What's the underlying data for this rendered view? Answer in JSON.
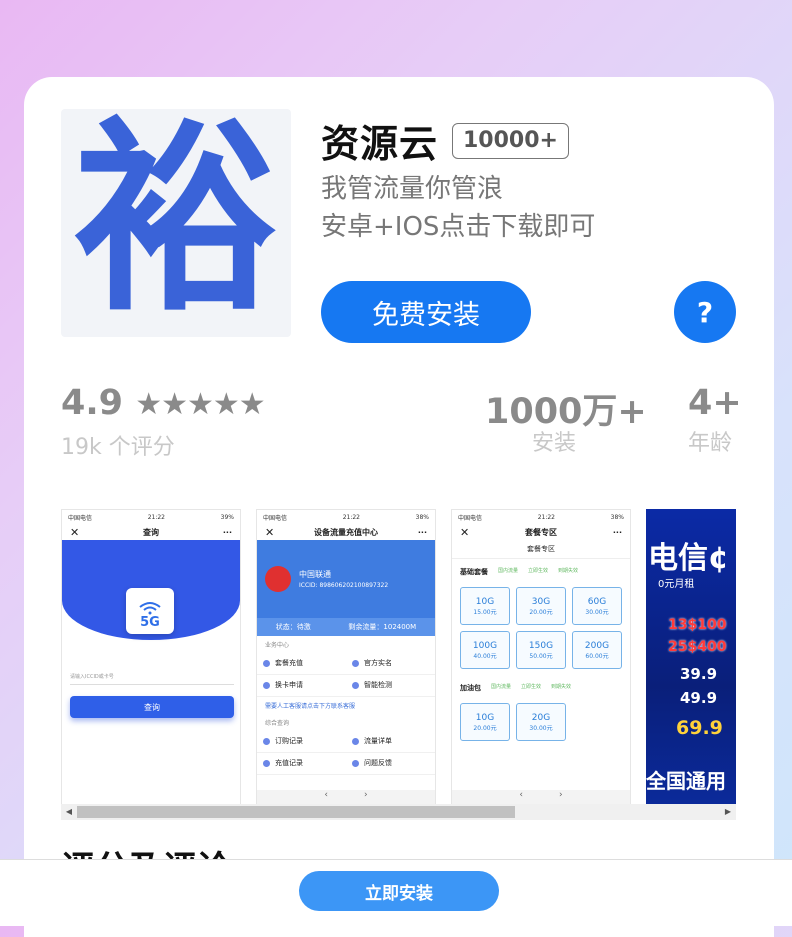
{
  "app": {
    "icon_glyph": "裕",
    "name": "资源云",
    "downloads_badge": "10000+",
    "slogan_line1": "我管流量你管浪",
    "slogan_line2": "安卓+IOS点击下载即可",
    "install_label": "免费安装",
    "help_label": "?"
  },
  "stats": {
    "rating": "4.9",
    "stars": "★★★★★",
    "rating_count": "19k 个评分",
    "installs": "1000万+",
    "installs_label": "安装",
    "age": "4+",
    "age_label": "年龄"
  },
  "screenshots": {
    "shot1": {
      "carrier": "中国电信",
      "time": "21:22",
      "battery": "39%",
      "close": "✕",
      "title": "查询",
      "more": "···",
      "badge": "5G",
      "input_hint": "请输入ICCID或卡号",
      "button": "查询"
    },
    "shot2": {
      "carrier": "中国电信",
      "time": "21:22",
      "battery": "38%",
      "close": "✕",
      "title": "设备流量充值中心",
      "more": "···",
      "operator": "中国联通",
      "iccid": "ICCID: 898606202100897322",
      "status_label": "状态：待激",
      "remaining_label": "剩余流量：102400M",
      "section1": "业务中心",
      "items": [
        "套餐充值",
        "官方实名",
        "换卡申请",
        "智能检测"
      ],
      "link": "需要人工客服请点击下方联系客服",
      "section2": "综合查询",
      "items2": [
        "订购记录",
        "流量详单",
        "充值记录",
        "问题反馈"
      ],
      "nav_back": "‹",
      "nav_fwd": "›"
    },
    "shot3": {
      "carrier": "中国电信",
      "time": "21:22",
      "battery": "38%",
      "close": "✕",
      "title": "套餐专区",
      "more": "···",
      "tab": "套餐专区",
      "group1": "基础套餐",
      "group1_opts": [
        "国内流量",
        "立即生效",
        "到期失效"
      ],
      "plans": [
        {
          "size": "10G",
          "price": "15.00元"
        },
        {
          "size": "30G",
          "price": "20.00元"
        },
        {
          "size": "60G",
          "price": "30.00元"
        },
        {
          "size": "100G",
          "price": "40.00元"
        },
        {
          "size": "150G",
          "price": "50.00元"
        },
        {
          "size": "200G",
          "price": "60.00元"
        }
      ],
      "group2": "加油包",
      "addons": [
        {
          "size": "10G",
          "price": "20.00元"
        },
        {
          "size": "20G",
          "price": "30.00元"
        }
      ],
      "nav_back": "‹",
      "nav_fwd": "›"
    },
    "shot4": {
      "title": "电信¢",
      "sub": "0元月租",
      "red1": "13$100",
      "red2": "25$400",
      "price1": "39.9",
      "price2": "49.9",
      "price3": "69.9",
      "bottom": "全国通用"
    }
  },
  "scrollbar": {
    "left_arrow": "◀",
    "right_arrow": "▶"
  },
  "next_section_title": "评分及评论",
  "bottom_install_label": "立即安装"
}
